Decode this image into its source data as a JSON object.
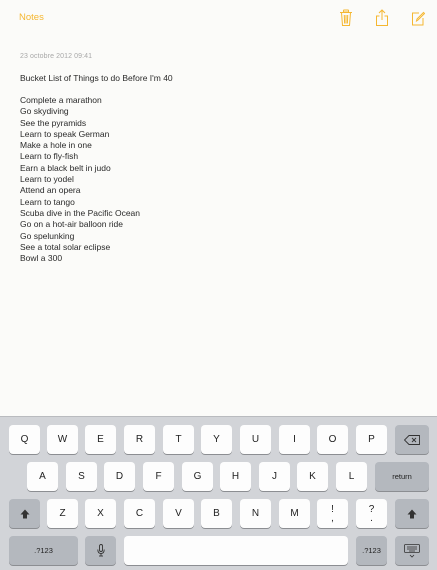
{
  "navbar": {
    "back_label": "Notes",
    "accent_color": "#f5b731",
    "icons": [
      "trash-icon",
      "share-icon",
      "compose-icon"
    ]
  },
  "note": {
    "date": "23 octobre 2012 09:41",
    "title": "Bucket List of Things to do Before I'm 40",
    "items": [
      "Complete a marathon",
      "Go skydiving",
      "See the pyramids",
      "Learn to speak German",
      "Make a hole in one",
      "Learn to fly-fish",
      "Earn a black belt in judo",
      "Learn to yodel",
      "Attend an opera",
      "Learn to tango",
      "Scuba dive in the Pacific Ocean",
      "Go on a hot-air balloon ride",
      "Go spelunking",
      "See a total solar eclipse",
      "Bowl a 300"
    ]
  },
  "keyboard": {
    "row1": [
      "Q",
      "W",
      "E",
      "R",
      "T",
      "Y",
      "U",
      "I",
      "O",
      "P"
    ],
    "row2": [
      "A",
      "S",
      "D",
      "F",
      "G",
      "H",
      "J",
      "K",
      "L"
    ],
    "row3": [
      "Z",
      "X",
      "C",
      "V",
      "B",
      "N",
      "M"
    ],
    "punct_exclaim": [
      "!",
      ","
    ],
    "punct_question": [
      "?",
      "."
    ],
    "return_label": "return",
    "numbers_label": ".?123",
    "icons": [
      "delete-icon",
      "shift-icon",
      "microphone-icon",
      "keyboard-dismiss-icon"
    ]
  }
}
